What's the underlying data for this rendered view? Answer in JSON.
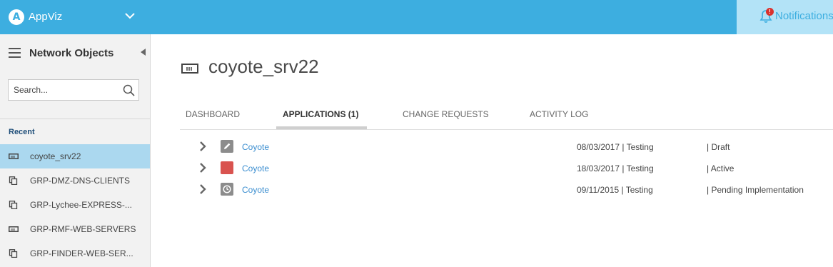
{
  "header": {
    "logo_letter": "A",
    "app_name": "AppViz",
    "notifications_label": "Notifications",
    "notifications_badge": "!",
    "colors": {
      "bar": "#3daee0",
      "notif_bg": "#b3e3f7",
      "badge": "#d9322e"
    }
  },
  "sidebar": {
    "title": "Network Objects",
    "search_placeholder": "Search...",
    "recent_label": "Recent",
    "items": [
      {
        "label": "coyote_srv22",
        "icon": "server-icon",
        "active": true
      },
      {
        "label": "GRP-DMZ-DNS-CLIENTS",
        "icon": "group-icon",
        "active": false
      },
      {
        "label": "GRP-Lychee-EXPRESS-...",
        "icon": "group-icon",
        "active": false
      },
      {
        "label": "GRP-RMF-WEB-SERVERS",
        "icon": "server-icon",
        "active": false
      },
      {
        "label": "GRP-FINDER-WEB-SER...",
        "icon": "group-icon",
        "active": false
      }
    ]
  },
  "main": {
    "title": "coyote_srv22",
    "tabs": [
      {
        "label": "DASHBOARD",
        "active": false
      },
      {
        "label": "APPLICATIONS (1)",
        "active": true
      },
      {
        "label": "CHANGE REQUESTS",
        "active": false
      },
      {
        "label": "ACTIVITY LOG",
        "active": false
      }
    ],
    "applications": [
      {
        "name": "Coyote",
        "date": "08/03/2017 | Testing",
        "status": "| Draft",
        "icon": "pencil-icon",
        "color": "#8c8c8c"
      },
      {
        "name": "Coyote",
        "date": "18/03/2017 | Testing",
        "status": "| Active",
        "icon": "active-square-icon",
        "color": "#d9534f"
      },
      {
        "name": "Coyote",
        "date": "09/11/2015 | Testing",
        "status": "| Pending Implementation",
        "icon": "clock-icon",
        "color": "#8c8c8c"
      }
    ]
  }
}
